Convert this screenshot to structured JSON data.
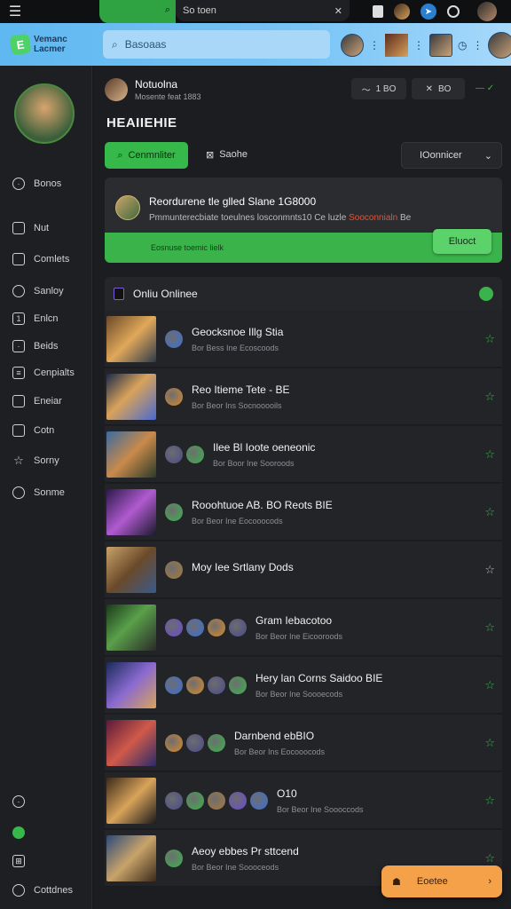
{
  "topbar": {
    "search_text": "So toen",
    "menu_icon": "hamburger-icon"
  },
  "header": {
    "logo_line1": "Vemanc",
    "logo_line2": "Lacmer",
    "search_placeholder": "Basoaas"
  },
  "sidebar": {
    "items": [
      {
        "label": "Bonos",
        "icon": "clock-icon"
      },
      {
        "label": "Nut",
        "icon": "chat-icon"
      },
      {
        "label": "Comlets",
        "icon": "calendar-icon"
      },
      {
        "label": "Sanloy",
        "icon": "search-icon"
      },
      {
        "label": "Enlcn",
        "icon": "list-icon"
      },
      {
        "label": "Beids",
        "icon": "box-icon"
      },
      {
        "label": "Cenpialts",
        "icon": "document-icon"
      },
      {
        "label": "Eneiar",
        "icon": "dashboard-icon"
      },
      {
        "label": "Cotn",
        "icon": "tablet-icon"
      },
      {
        "label": "Sorny",
        "icon": "star-icon"
      },
      {
        "label": "Sonme",
        "icon": "shield-icon"
      }
    ],
    "bottom_label": "Cottdnes"
  },
  "user": {
    "name": "Notuolna",
    "subtitle": "Mosente feat 1883",
    "pill1": "1 BO",
    "pill2": "BO"
  },
  "page_title": "HEAIIEHIE",
  "filters": {
    "primary_button": "Cenmnliter",
    "tab": "Saohe",
    "select_value": "IOonnicer"
  },
  "announcement": {
    "title": "Reordurene tle glled Slane 1G8000",
    "subtitle": "Pmmunterecbiate toeulnes losconmnts10 Ce luzle ",
    "subtitle_accent": "Sooconnialn",
    "subtitle_end": " Be",
    "bar_text": "Eosnuse toemic lielk",
    "button": "Eluoct"
  },
  "list": {
    "header": "Onliu Onlinee",
    "rows": [
      {
        "title": "Geocksnoe Illg Stia",
        "sub": "Bor Bess Ine Ecoscoods",
        "star": "green",
        "icons": 1
      },
      {
        "title": "Reo Itieme Tete - BE",
        "sub": "Bor Beor Ins Socnooooils",
        "star": "green",
        "icons": 1
      },
      {
        "title": "Ilee Bl Ioote oeneonic",
        "sub": "Bor Boor Ine Sooroods",
        "star": "green",
        "icons": 2
      },
      {
        "title": "Rooohtuoe AB. BO Reots BIE",
        "sub": "Bor Beor Ine Eocooocods",
        "star": "green",
        "icons": 1
      },
      {
        "title": "Moy Iee Srtlany Dods",
        "sub": "",
        "star": "grey",
        "icons": 1
      },
      {
        "title": "Gram Iebacotoo",
        "sub": "Bor Beor Ine Eicooroods",
        "star": "green",
        "icons": 4
      },
      {
        "title": "Hery lan Corns Saidoo BIE",
        "sub": "Bor Beor Ine Soooecods",
        "star": "green",
        "icons": 4
      },
      {
        "title": "Darnbend ebBIO",
        "sub": "Bor Beor Ins Eocooocods",
        "star": "green",
        "icons": 3
      },
      {
        "title": "O10",
        "sub": "Bor Beor Ine Soooccods",
        "star": "green",
        "icons": 5
      },
      {
        "title": "Aeoy ebbes Pr sttcend",
        "sub": "Bor Beor Ine Soooceods",
        "star": "green",
        "icons": 1
      }
    ]
  },
  "fab": {
    "label": "Eoetee"
  }
}
